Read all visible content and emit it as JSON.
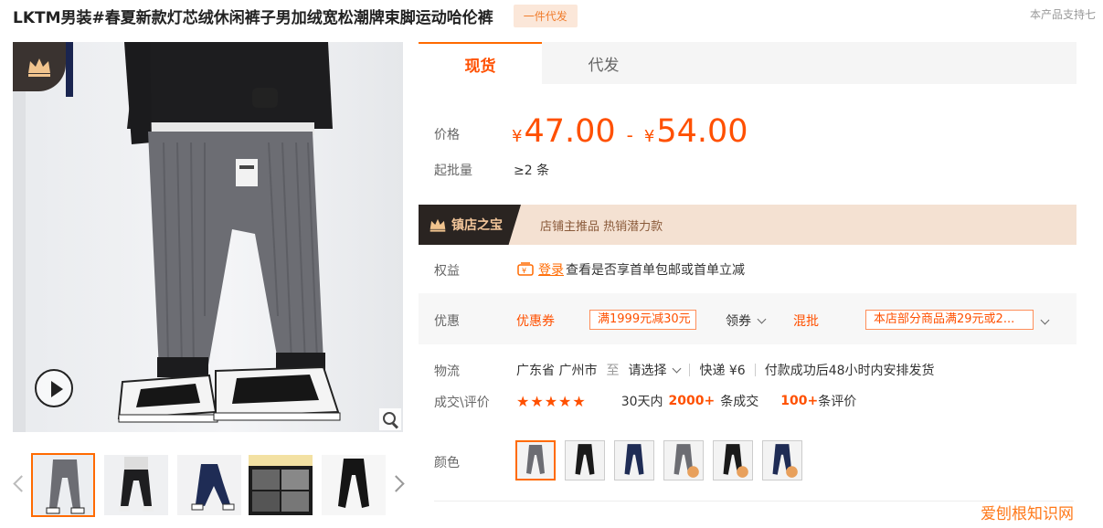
{
  "product": {
    "title": "LKTM男装#春夏新款灯芯绒休闲裤子男加绒宽松潮牌束脚运动哈伦裤",
    "tag": "一件代发",
    "support_note": "本产品支持七"
  },
  "tabs": [
    {
      "label": "现货",
      "active": true
    },
    {
      "label": "代发",
      "active": false
    }
  ],
  "price": {
    "label": "价格",
    "currency": "¥",
    "min": "47.00",
    "max": "54.00",
    "separator": "-"
  },
  "moq": {
    "label": "起批量",
    "value": "≥2 条"
  },
  "treasure": {
    "title": "镇店之宝",
    "desc": "店铺主推品  热销潜力款"
  },
  "rights": {
    "label": "权益",
    "login": "登录",
    "text": "查看是否享首单包邮或首单立减"
  },
  "promo": {
    "label": "优惠",
    "coupon_type": "优惠券",
    "coupon_value": "满1999元减30元",
    "coupon_get": "领券",
    "batch_type": "混批",
    "batch_value": "本店部分商品满29元或2..."
  },
  "logistics": {
    "label": "物流",
    "from": "广东省 广州市",
    "to_word": "至",
    "destination": "请选择",
    "express": "快递 ¥6",
    "dispatch": "付款成功后48小时内安排发货"
  },
  "reviews": {
    "label": "成交\\评价",
    "rating": 4.5,
    "stars": "★★★★★",
    "deals_prefix": "30天内",
    "deals_count": "2000+",
    "deals_suffix": "条成交",
    "review_count": "100+",
    "review_suffix": "条评价"
  },
  "color": {
    "label": "颜色",
    "swatches": [
      "grey",
      "black",
      "navy",
      "grey-fleece",
      "black-fleece",
      "navy-fleece"
    ],
    "selected": 0
  },
  "watermark": "爱刨根知识网",
  "colors": {
    "accent": "#ff5000",
    "tag_bg": "#fbe7d9",
    "treasure_bg": "#f4e1d2"
  },
  "icons": [
    "crown-icon",
    "play-icon",
    "zoom-icon",
    "chevron-left-icon",
    "chevron-right-icon",
    "coupon-icon",
    "chevron-down-icon",
    "star-icon"
  ]
}
